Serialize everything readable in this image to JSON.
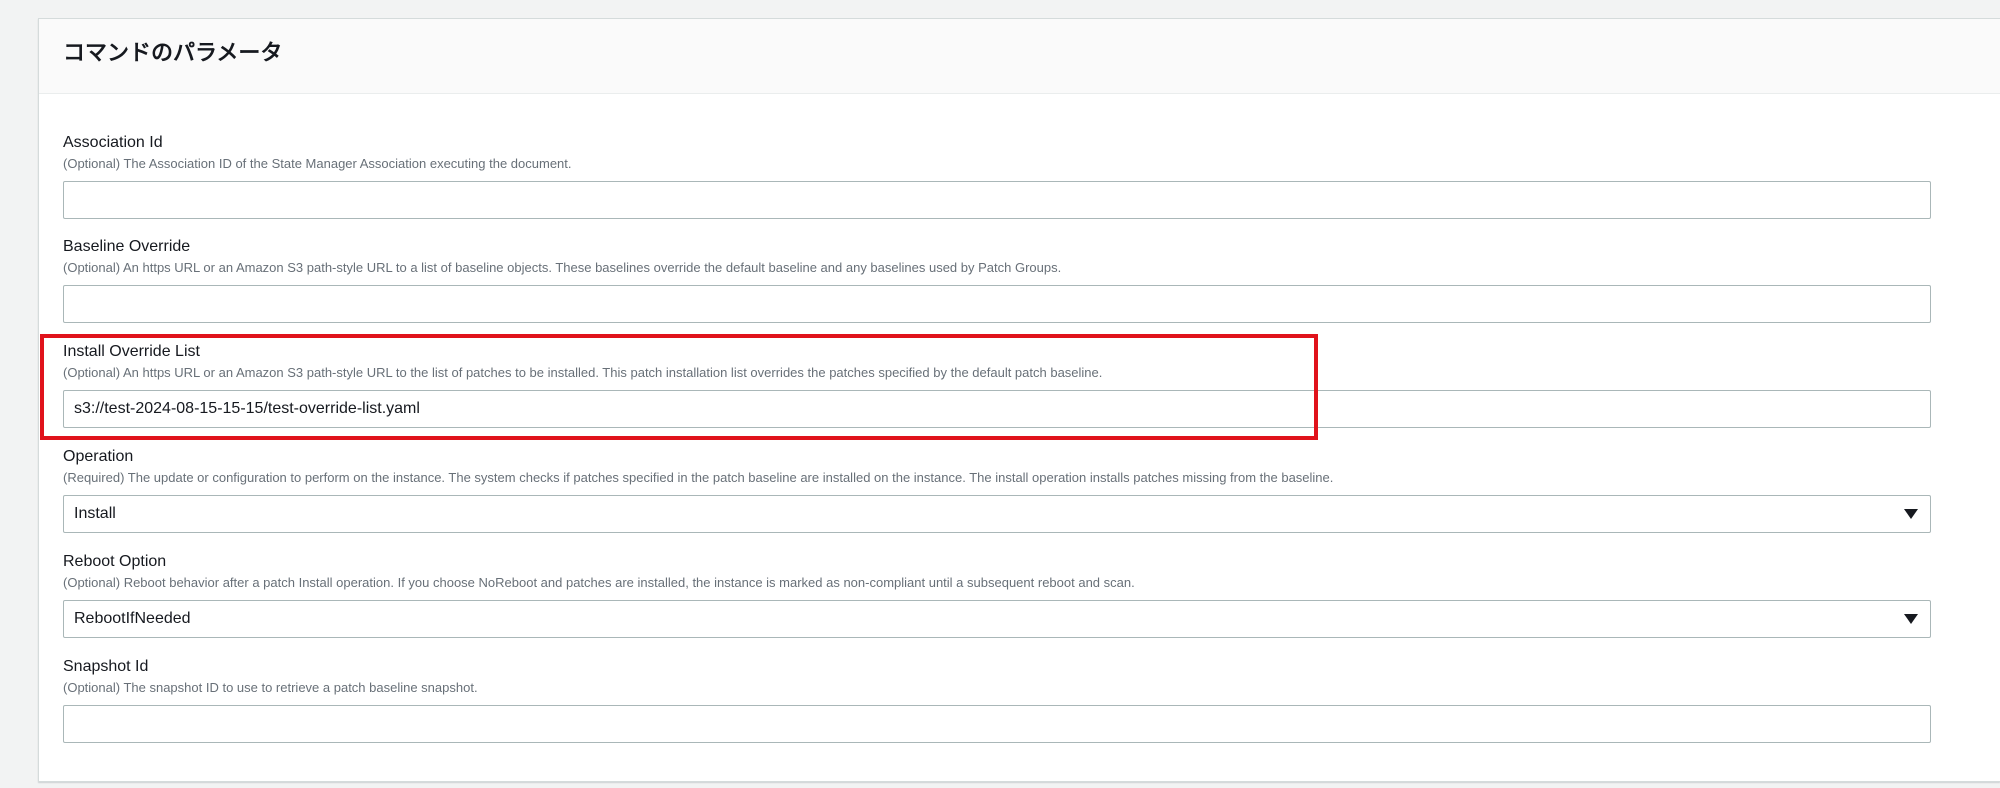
{
  "panel": {
    "title": "コマンドのパラメータ"
  },
  "fields": [
    {
      "label": "Association Id",
      "description": "(Optional) The Association ID of the State Manager Association executing the document.",
      "type": "text",
      "value": ""
    },
    {
      "label": "Baseline Override",
      "description": "(Optional) An https URL or an Amazon S3 path-style URL to a list of baseline objects. These baselines override the default baseline and any baselines used by Patch Groups.",
      "type": "text",
      "value": ""
    },
    {
      "label": "Install Override List",
      "description": "(Optional) An https URL or an Amazon S3 path-style URL to the list of patches to be installed. This patch installation list overrides the patches specified by the default patch baseline.",
      "type": "text",
      "value": "s3://test-2024-08-15-15-15/test-override-list.yaml"
    },
    {
      "label": "Operation",
      "description": "(Required) The update or configuration to perform on the instance. The system checks if patches specified in the patch baseline are installed on the instance. The install operation installs patches missing from the baseline.",
      "type": "select",
      "value": "Install"
    },
    {
      "label": "Reboot Option",
      "description": "(Optional) Reboot behavior after a patch Install operation. If you choose NoReboot and patches are installed, the instance is marked as non-compliant until a subsequent reboot and scan.",
      "type": "select",
      "value": "RebootIfNeeded"
    },
    {
      "label": "Snapshot Id",
      "description": "(Optional) The snapshot ID to use to retrieve a patch baseline snapshot.",
      "type": "text",
      "value": ""
    }
  ],
  "colors": {
    "highlight": "#e0121b",
    "label": "#16191f",
    "description": "#687078",
    "border": "#aab7b8"
  },
  "icons": {
    "select_caret": "caret-down-icon"
  }
}
